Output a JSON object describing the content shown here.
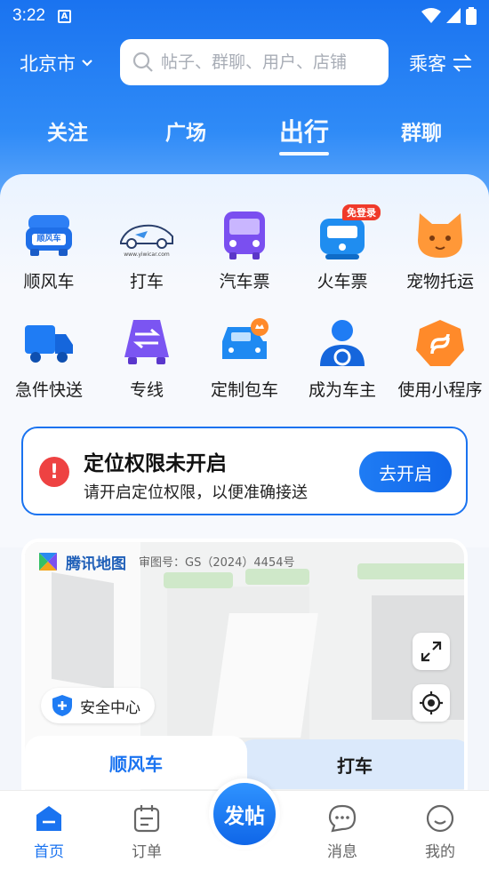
{
  "status_bar": {
    "time": "3:22",
    "notification": "A"
  },
  "header": {
    "city": "北京市",
    "search_placeholder": "帖子、群聊、用户、店铺",
    "role": "乘客"
  },
  "tabs": [
    {
      "label": "关注",
      "active": false
    },
    {
      "label": "广场",
      "active": false
    },
    {
      "label": "出行",
      "active": true
    },
    {
      "label": "群聊",
      "active": false
    }
  ],
  "services": [
    {
      "label": "顺风车",
      "icon": "carpool-car-icon",
      "icon_text": "顺风车"
    },
    {
      "label": "打车",
      "icon": "taxi-logo-icon",
      "icon_text": "www.yiwicar.com"
    },
    {
      "label": "汽车票",
      "icon": "bus-icon"
    },
    {
      "label": "火车票",
      "icon": "train-icon",
      "badge": "免登录"
    },
    {
      "label": "宠物托运",
      "icon": "cat-icon"
    },
    {
      "label": "急件快送",
      "icon": "truck-icon"
    },
    {
      "label": "专线",
      "icon": "shuttle-swap-icon"
    },
    {
      "label": "定制包车",
      "icon": "charter-car-icon"
    },
    {
      "label": "成为车主",
      "icon": "driver-person-icon"
    },
    {
      "label": "使用小程序",
      "icon": "mini-program-icon"
    }
  ],
  "location_banner": {
    "title": "定位权限未开启",
    "subtitle": "请开启定位权限，以便准确接送",
    "button": "去开启"
  },
  "map": {
    "provider": "腾讯地图",
    "approval": "审图号：GS（2024）4454号",
    "safety_label": "安全中心",
    "mode_tabs": [
      "顺风车",
      "打车"
    ]
  },
  "bottom_nav": {
    "items": [
      {
        "label": "首页",
        "icon": "home-icon",
        "active": true
      },
      {
        "label": "订单",
        "icon": "order-calendar-icon",
        "active": false
      },
      {
        "label": "消息",
        "icon": "message-bubble-icon",
        "active": false
      },
      {
        "label": "我的",
        "icon": "smile-face-icon",
        "active": false
      }
    ],
    "post_button": "发帖"
  },
  "colors": {
    "primary": "#1a73f0",
    "alert": "#ee4242",
    "badge": "#f03a2a"
  }
}
